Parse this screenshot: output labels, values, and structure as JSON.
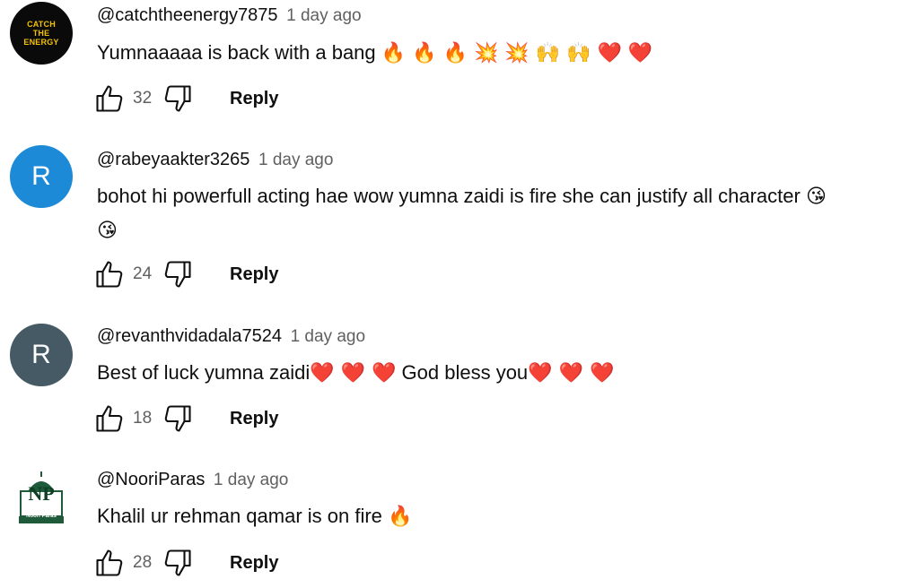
{
  "comments": [
    {
      "author": "@catchtheenergy7875",
      "time": "1 day ago",
      "text": "Yumnaaaaa is back with a bang",
      "emojis": "🔥 🔥 🔥 💥 💥 🙌 🙌 ❤️ ❤️",
      "likes": "32",
      "reply": "Reply",
      "avatar_text": [
        "CATCH",
        "THE",
        "ENERGY"
      ]
    },
    {
      "author": "@rabeyaakter3265",
      "time": "1 day ago",
      "text_line1": "bohot hi powerfull acting hae wow yumna zaidi is fire she can justify all character",
      "emoji_line1": "😘",
      "emoji_line2": "😘",
      "likes": "24",
      "reply": "Reply",
      "avatar_letter": "R",
      "avatar_color": "#1c8ad6"
    },
    {
      "author": "@revanthvidadala7524",
      "time": "1 day ago",
      "text_a": "Best of luck yumna zaidi",
      "emojis_a": "❤️ ❤️ ❤️",
      "text_b": "God bless you",
      "emojis_b": "❤️ ❤️ ❤️",
      "likes": "18",
      "reply": "Reply",
      "avatar_letter": "R",
      "avatar_color": "#455a64"
    },
    {
      "author": "@NooriParas",
      "time": "1 day ago",
      "text": "Khalil ur rehman qamar is on fire",
      "emojis": "🔥",
      "likes": "28",
      "reply": "Reply",
      "avatar_text": [
        "NP",
        "Noori Paras"
      ]
    }
  ],
  "icons": {
    "like": "thumbs-up-icon",
    "dislike": "thumbs-down-icon"
  },
  "colors": {
    "text": "#0f0f0f",
    "secondary": "#606060",
    "avatar_blue": "#1c8ad6",
    "avatar_slate": "#455a64",
    "np_green": "#1f5a3a"
  }
}
